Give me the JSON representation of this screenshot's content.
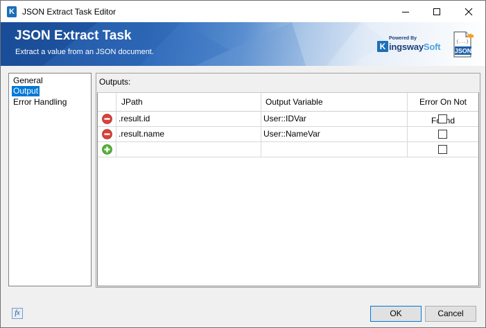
{
  "window": {
    "title": "JSON Extract Task Editor"
  },
  "banner": {
    "title": "JSON Extract Task",
    "subtitle": "Extract a value from an JSON document.",
    "powered_by": "Powered By",
    "brand_k": "K",
    "brand_name_part1": "ingsway",
    "brand_name_part2": "Soft",
    "json_logo_text": "JSON",
    "json_logo_braces": "{...}"
  },
  "nav": {
    "items": [
      {
        "label": "General",
        "selected": false
      },
      {
        "label": "Output",
        "selected": true
      },
      {
        "label": "Error Handling",
        "selected": false
      }
    ]
  },
  "outputs": {
    "title": "Outputs:",
    "columns": [
      "JPath",
      "Output Variable",
      "Error On Not Found"
    ],
    "rows": [
      {
        "action": "remove",
        "jpath": ".result.id",
        "variable": "User::IDVar",
        "error_on_not_found": false
      },
      {
        "action": "remove",
        "jpath": ".result.name",
        "variable": "User::NameVar",
        "error_on_not_found": false
      },
      {
        "action": "add",
        "jpath": "",
        "variable": "",
        "error_on_not_found": false
      }
    ]
  },
  "footer": {
    "fx_label": "fx",
    "ok_label": "OK",
    "cancel_label": "Cancel"
  },
  "colors": {
    "selection": "#0078d7",
    "banner_dark": "#1b4f9c",
    "remove_icon": "#d9423a",
    "add_icon": "#56b138"
  },
  "icons": [
    "app-icon",
    "minimize-icon",
    "maximize-icon",
    "close-icon",
    "remove-row-icon",
    "add-row-icon",
    "expression-icon",
    "json-logo-icon"
  ]
}
